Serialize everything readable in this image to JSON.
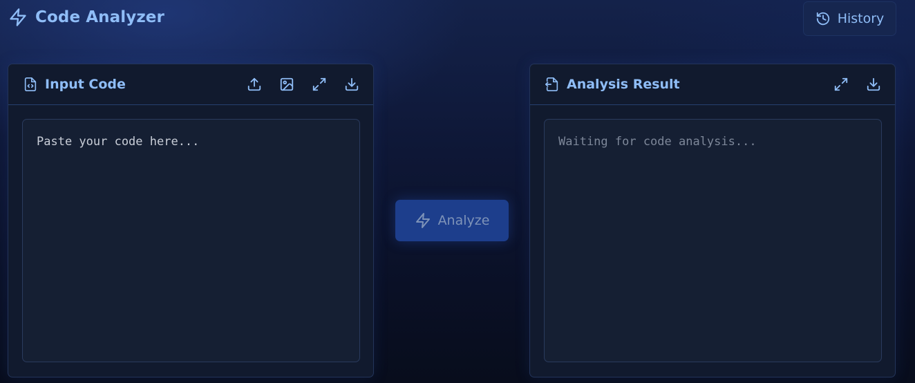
{
  "header": {
    "title": "Code Analyzer",
    "title_icon": "lightning-icon",
    "history_label": "History",
    "history_icon": "history-icon"
  },
  "input_panel": {
    "title": "Input Code",
    "title_icon": "file-code-icon",
    "tools": [
      "upload-icon",
      "image-icon",
      "expand-icon",
      "download-icon"
    ],
    "editor_value": "",
    "editor_placeholder": "Paste your code here..."
  },
  "analyze": {
    "label": "Analyze",
    "icon": "lightning-icon"
  },
  "result_panel": {
    "title": "Analysis Result",
    "title_icon": "file-output-icon",
    "tools": [
      "expand-icon",
      "download-icon"
    ],
    "placeholder": "Waiting for code analysis..."
  },
  "colors": {
    "accent": "#8fbdf7",
    "panel_bg": "#111a2e",
    "analyze_bg": "#1d3e8c",
    "history_bg": "#16264f"
  }
}
